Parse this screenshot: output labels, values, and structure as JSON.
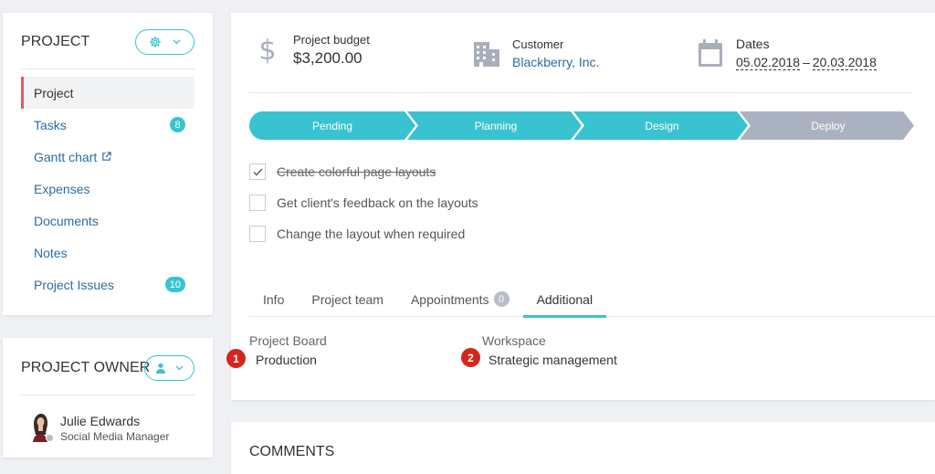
{
  "project_panel": {
    "title": "PROJECT",
    "nav": [
      {
        "label": "Project",
        "active": true
      },
      {
        "label": "Tasks",
        "badge": "8"
      },
      {
        "label": "Gantt chart",
        "external": true
      },
      {
        "label": "Expenses"
      },
      {
        "label": "Documents"
      },
      {
        "label": "Notes"
      },
      {
        "label": "Project Issues",
        "badge": "10"
      }
    ]
  },
  "owner_panel": {
    "title": "PROJECT OWNER",
    "name": "Julie Edwards",
    "role": "Social Media Manager"
  },
  "summary": {
    "budget_label": "Project budget",
    "budget_value": "$3,200.00",
    "customer_label": "Customer",
    "customer_value": "Blackberry, Inc.",
    "dates_label": "Dates",
    "date_start": "05.02.2018",
    "date_sep": "–",
    "date_end": "20.03.2018"
  },
  "stages": [
    {
      "label": "Pending",
      "completed": true
    },
    {
      "label": "Planning",
      "completed": true
    },
    {
      "label": "Design",
      "completed": true
    },
    {
      "label": "Deploy",
      "completed": false
    }
  ],
  "tasks": [
    {
      "label": "Create colorful page layouts",
      "done": true
    },
    {
      "label": "Get client's feedback on the layouts",
      "done": false
    },
    {
      "label": "Change the layout when required",
      "done": false
    }
  ],
  "tabs": [
    {
      "label": "Info"
    },
    {
      "label": "Project team"
    },
    {
      "label": "Appointments",
      "badge": "0"
    },
    {
      "label": "Additional",
      "active": true
    }
  ],
  "additional": {
    "board_label": "Project Board",
    "board_value": "Production",
    "board_marker": "1",
    "workspace_label": "Workspace",
    "workspace_value": "Strategic management",
    "workspace_marker": "2"
  },
  "comments": {
    "title": "COMMENTS"
  },
  "colors": {
    "accent": "#39c3d0",
    "link": "#2b6ca3",
    "stage_done": "#39c3d0",
    "stage_todo": "#aab2c2",
    "marker": "#d5261d",
    "active_bar": "#e05a67"
  }
}
